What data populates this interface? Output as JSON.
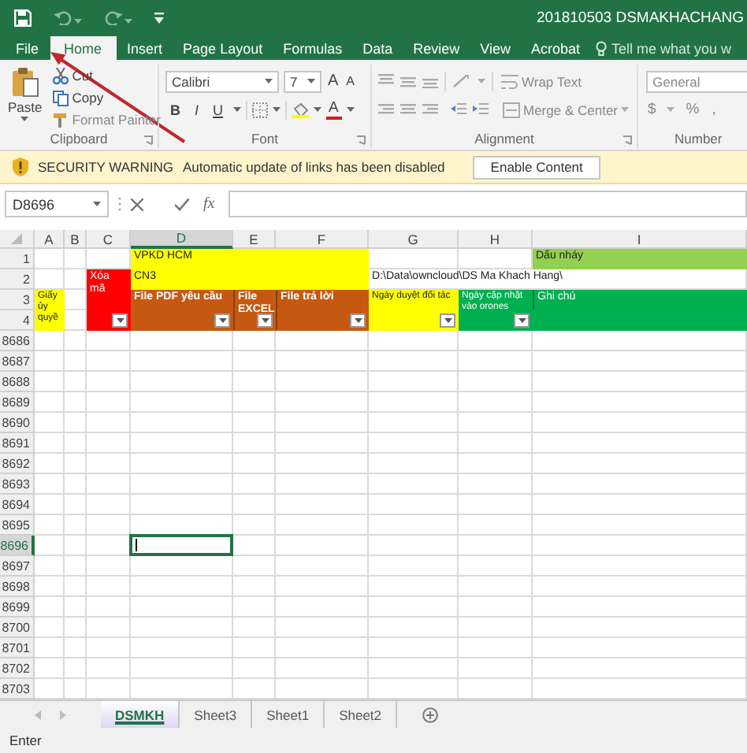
{
  "window": {
    "title": "201810503 DSMAKHACHANG"
  },
  "ribbon_tabs": [
    {
      "label": "File",
      "selected": false
    },
    {
      "label": "Home",
      "selected": true
    },
    {
      "label": "Insert",
      "selected": false
    },
    {
      "label": "Page Layout",
      "selected": false
    },
    {
      "label": "Formulas",
      "selected": false
    },
    {
      "label": "Data",
      "selected": false
    },
    {
      "label": "Review",
      "selected": false
    },
    {
      "label": "View",
      "selected": false
    },
    {
      "label": "Acrobat",
      "selected": false
    }
  ],
  "tell_me": {
    "placeholder": "Tell me what you w"
  },
  "ribbon": {
    "clipboard": {
      "paste": "Paste",
      "items": [
        "Cut",
        "Copy",
        "Format Painter"
      ],
      "label": "Clipboard"
    },
    "font": {
      "name": "Calibri",
      "size": "7",
      "size_buttons": [
        "A",
        "A"
      ],
      "style_buttons": [
        "B",
        "I",
        "U"
      ],
      "color_button": "A",
      "label": "Font"
    },
    "alignment": {
      "wrap": "Wrap Text",
      "merge": "Merge & Center",
      "label": "Alignment"
    },
    "number": {
      "format": "General",
      "buttons": [
        "$",
        "%",
        ","
      ],
      "label": "Number"
    }
  },
  "security_bar": {
    "title": "SECURITY WARNING",
    "message": "Automatic update of links has been disabled",
    "button": "Enable Content"
  },
  "formula_bar": {
    "name_box": "D8696",
    "function_label": "fx"
  },
  "sheet": {
    "columns": [
      {
        "label": "A",
        "selected": false
      },
      {
        "label": "B",
        "selected": false
      },
      {
        "label": "C",
        "selected": false
      },
      {
        "label": "D",
        "selected": true
      },
      {
        "label": "E",
        "selected": false
      },
      {
        "label": "F",
        "selected": false
      },
      {
        "label": "G",
        "selected": false
      },
      {
        "label": "H",
        "selected": false
      },
      {
        "label": "I",
        "selected": false
      }
    ],
    "header_rows": [
      {
        "number": "1",
        "selected": false,
        "cells": [
          {},
          {},
          {},
          {
            "color": "#ffff00",
            "text": "VPKD HCM",
            "bold": false
          },
          {
            "color": "#ffff00"
          },
          {
            "color": "#ffff00"
          },
          {},
          {},
          {
            "color": "#92d050",
            "text": "Dấu nháy",
            "bold": false
          }
        ]
      },
      {
        "number": "2",
        "selected": false,
        "cells": [
          {},
          {},
          {
            "color": "#ff0000",
            "text": "Xóa mã",
            "bold": false
          },
          {
            "color": "#ffff00",
            "text": "CN3",
            "bold": false
          },
          {
            "color": "#ffff00"
          },
          {
            "color": "#ffff00"
          },
          {
            "text": "D:\\Data\\owncloud\\DS Ma Khach Hang\\",
            "bold": false
          },
          {},
          {}
        ]
      },
      {
        "number": "3",
        "selected": false,
        "cells": [
          {
            "color": "#ffff00",
            "text": "Giấy ủy quyề",
            "bold": false
          },
          {},
          {
            "color": "#ff0000"
          },
          {
            "color": "#c65911",
            "text": "File PDF yêu cầu",
            "bold": true
          },
          {
            "color": "#c65911",
            "text": "File EXCEL",
            "bold": true
          },
          {
            "color": "#c65911",
            "text": "File trả lời",
            "bold": true
          },
          {
            "color": "#ffff00",
            "text": "Ngày duyệt đối tác",
            "bold": false
          },
          {
            "color": "#00b050",
            "text": "Ngày cập nhật vào orones",
            "bold": false
          },
          {
            "color": "#00b050",
            "text": "Ghi chú",
            "bold": false
          }
        ]
      },
      {
        "number": "4",
        "selected": false,
        "cells": [
          {
            "color": "#ffff00",
            "filter": false
          },
          {
            "filter": false
          },
          {
            "color": "#ff0000",
            "filter": true
          },
          {
            "color": "#c65911",
            "filter": true
          },
          {
            "color": "#c65911",
            "filter": true
          },
          {
            "color": "#c65911",
            "filter": true
          },
          {
            "color": "#ffff00",
            "filter": true
          },
          {
            "color": "#00b050",
            "filter": true
          },
          {
            "color": "#00b050",
            "filter": false
          }
        ]
      }
    ],
    "rows": [
      {
        "number": "8686",
        "selected": false
      },
      {
        "number": "8687",
        "selected": false
      },
      {
        "number": "8688",
        "selected": false
      },
      {
        "number": "8689",
        "selected": false
      },
      {
        "number": "8690",
        "selected": false
      },
      {
        "number": "8691",
        "selected": false
      },
      {
        "number": "8692",
        "selected": false
      },
      {
        "number": "8693",
        "selected": false
      },
      {
        "number": "8694",
        "selected": false
      },
      {
        "number": "8695",
        "selected": false
      },
      {
        "number": "8696",
        "selected": true
      },
      {
        "number": "8697",
        "selected": false
      },
      {
        "number": "8698",
        "selected": false
      },
      {
        "number": "8699",
        "selected": false
      },
      {
        "number": "8700",
        "selected": false
      },
      {
        "number": "8701",
        "selected": false
      },
      {
        "number": "8702",
        "selected": false
      },
      {
        "number": "8703",
        "selected": false
      }
    ]
  },
  "sheet_tabs": [
    {
      "label": "DSMKH",
      "selected": true
    },
    {
      "label": "Sheet3",
      "selected": false
    },
    {
      "label": "Sheet1",
      "selected": false
    },
    {
      "label": "Sheet2",
      "selected": false
    }
  ],
  "status_bar": {
    "text": "Enter"
  }
}
